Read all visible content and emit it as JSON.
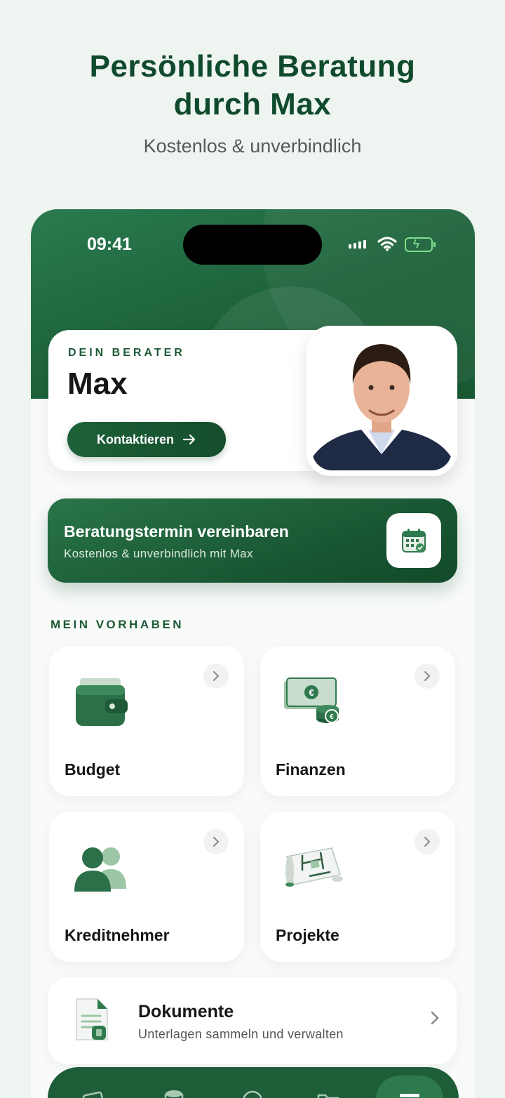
{
  "promo": {
    "title_line1": "Persönliche Beratung",
    "title_line2": "durch Max",
    "subtitle": "Kostenlos & unverbindlich"
  },
  "status_bar": {
    "time": "09:41"
  },
  "advisor": {
    "label": "DEIN BERATER",
    "name": "Max",
    "contact_label": "Kontaktieren",
    "contact_icon": "arrow-right-icon",
    "photo_icon": "advisor-photo"
  },
  "appointment": {
    "title": "Beratungstermin vereinbaren",
    "subtitle": "Kostenlos & unverbindlich mit Max",
    "icon": "calendar-icon"
  },
  "section": {
    "title": "MEIN VORHABEN"
  },
  "tiles": [
    {
      "label": "Budget",
      "icon": "wallet-icon"
    },
    {
      "label": "Finanzen",
      "icon": "money-icon"
    },
    {
      "label": "Kreditnehmer",
      "icon": "people-icon"
    },
    {
      "label": "Projekte",
      "icon": "floorplan-icon"
    }
  ],
  "documents": {
    "title": "Dokumente",
    "subtitle": "Unterlagen sammeln und verwalten",
    "icon": "document-icon"
  },
  "tabbar": {
    "tabs": [
      "cards-icon",
      "coins-icon",
      "chat-icon",
      "folder-icon",
      "menu-icon"
    ],
    "active_index": 4
  },
  "colors": {
    "brand_green": "#1d6139",
    "dark_green": "#0f4a2c",
    "background": "#eef4ef"
  }
}
